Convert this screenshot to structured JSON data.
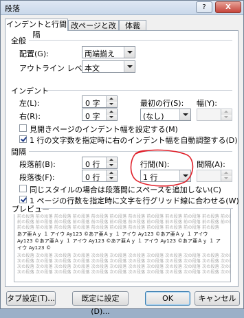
{
  "window": {
    "title": "段落",
    "help_label": "?",
    "close_label": "X"
  },
  "tabs": [
    {
      "label": "インデントと行間隔"
    },
    {
      "label": "改ページと改行"
    },
    {
      "label": "体裁"
    }
  ],
  "general": {
    "section": "全般",
    "alignment_label": "配置(G):",
    "alignment_value": "両端揃え",
    "outline_label": "アウトライン レベル(O):",
    "outline_value": "本文"
  },
  "indent": {
    "section": "インデント",
    "left_label": "左(L):",
    "left_value": "0 字",
    "right_label": "右(R):",
    "right_value": "0 字",
    "first_line_label": "最初の行(S):",
    "first_line_value": "(なし)",
    "width_label": "幅(Y):",
    "width_value": "",
    "mirror_label": "見開きページのインデント幅を設定する(M)",
    "mirror_checked": false,
    "auto_adjust_label": "1 行の文字数を指定時に右のインデント幅を自動調整する(D)",
    "auto_adjust_checked": true
  },
  "spacing": {
    "section": "間隔",
    "before_label": "段落前(B):",
    "before_value": "0 行",
    "after_label": "段落後(F):",
    "after_value": "0 行",
    "line_spacing_label": "行間(N):",
    "line_spacing_value": "1 行",
    "at_label": "間隔(A):",
    "at_value": "",
    "no_space_same_style_label": "同じスタイルの場合は段落間にスペースを追加しない(C)",
    "no_space_same_style_checked": false,
    "snap_grid_label": "1 ページの行数を指定時に文字を行グリッド線に合わせる(W)",
    "snap_grid_checked": true
  },
  "preview": {
    "section": "プレビュー",
    "gray_line_1": "前の段落 前の段落 前の段落 前の段落 前の段落 前の段落 前の段落 前の段落 前の段落 前の段落 前の段落 前の段落 前の段落",
    "gray_line_2": "前の段落 前の段落 前の段落 前の段落 前の段落 前の段落 前の段落 前の段落 前の段落 前の段落 前の段落 前の段落 前の段落",
    "gray_line_3": "前の段落 前の段落 前の段落 前の段落 前の段落 前の段落 前の段落 前の段落 前の段落 前の段落 前の段落",
    "sample_line_1": "あア亜Ａｙ １ アイウ Ay123 ©あア亜Ａｙ １ アイウ Ay123 ©あア亜Ａｙ １ アイウ",
    "sample_line_2": "Ay123 ©あア亜Ａｙ １ アイウ Ay123 ©あア亜Ａｙ １ アイウ Ay123 ©あア亜Ａｙ １ ア",
    "sample_line_3": "イウ Ay123 ©",
    "gray_line_4": "次の段落 次の段落 次の段落 次の段落 次の段落 次の段落 次の段落 次の段落 次の段落 次の段落 次の段落 次の段落 次の段落",
    "gray_line_5": "次の段落 次の段落 次の段落 次の段落 次の段落 次の段落 次の段落 次の段落 次の段落 次の段落 次の段落 次の段落 次の段落",
    "gray_line_6": "次の段落 次の段落 次の段落 次の段落 次の段落 次の段落 次の段落 次の段落 次の段落 次の段落 次の段落 次の段落 次の段落",
    "gray_line_7": "次の段落 次の段落 次の段落 次の段落 次の段落 次の段落 次の段落 次の段落 次の段落 次の段落 次の段落 次の段落 次の段落"
  },
  "buttons": {
    "tabs": "タブ設定(T)...",
    "set_default": "既定に設定(D)...",
    "ok": "OK",
    "cancel": "キャンセル"
  },
  "colors": {
    "annotation": "#e0202a",
    "checkmark": "#1d3a87"
  }
}
